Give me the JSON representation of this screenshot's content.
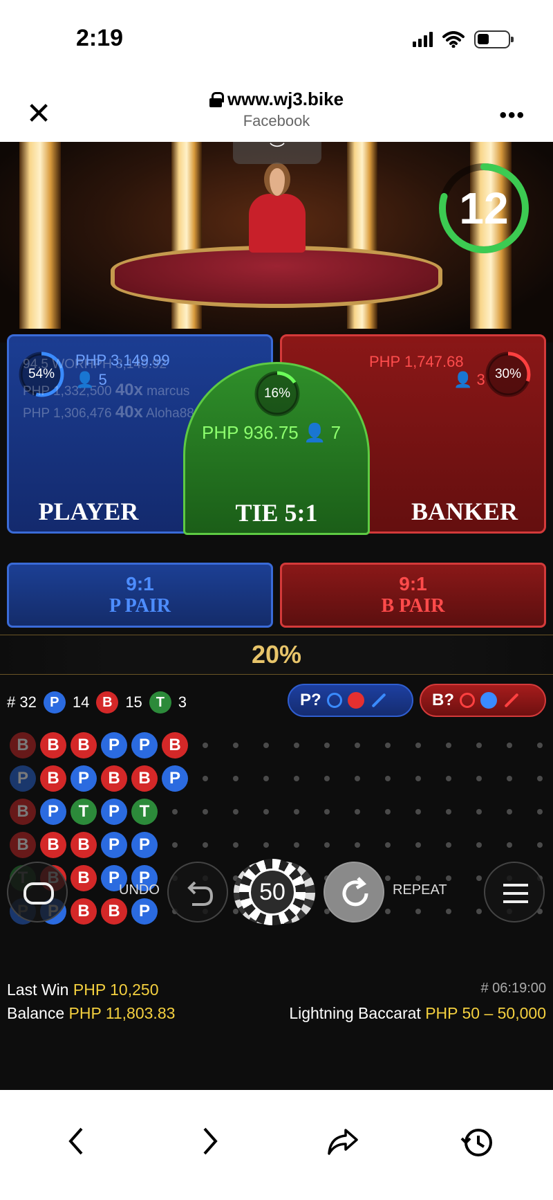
{
  "status_bar": {
    "time": "2:19"
  },
  "browser": {
    "url": "www.wj3.bike",
    "source": "Facebook"
  },
  "timer": {
    "seconds": "12"
  },
  "player": {
    "label": "PLAYER",
    "percent": "54%",
    "amount": "PHP 3,149.99",
    "players": "5",
    "ghost_rows": [
      {
        "text": "94.5 WORHPH 3,149.92"
      },
      {
        "amount": "PHP 1,332,500",
        "mult": "40x",
        "name": "marcus"
      },
      {
        "amount": "PHP 1,306,476",
        "mult": "40x",
        "name": "Aloha889"
      }
    ]
  },
  "tie": {
    "label": "TIE 5:1",
    "percent": "16%",
    "amount": "PHP 936.75",
    "players": "7"
  },
  "banker": {
    "label": "BANKER",
    "percent": "30%",
    "amount": "PHP 1,747.68",
    "players": "3"
  },
  "player_pair": {
    "odds": "9:1",
    "label": "P PAIR"
  },
  "banker_pair": {
    "odds": "9:1",
    "label": "B PAIR"
  },
  "multiplier": "20%",
  "stats": {
    "round": "# 32",
    "p_letter": "P",
    "p_count": "14",
    "b_letter": "B",
    "b_count": "15",
    "t_letter": "T",
    "t_count": "3"
  },
  "predictions": {
    "player": "P?",
    "banker": "B?"
  },
  "road": {
    "columns": [
      [
        "B",
        "P",
        "B",
        "B",
        "T",
        "P"
      ],
      [
        "B",
        "B",
        "P",
        "B",
        "B",
        "P"
      ],
      [
        "B",
        "P",
        "T",
        "B",
        "B",
        "B"
      ],
      [
        "P",
        "B",
        "P",
        "P",
        "P",
        "B"
      ],
      [
        "P",
        "B",
        "T",
        "P",
        "P",
        "P"
      ],
      [
        "B",
        "P"
      ]
    ]
  },
  "controls": {
    "undo": "UNDO",
    "chip_value": "50",
    "repeat": "REPEAT"
  },
  "footer": {
    "last_win_label": "Last Win",
    "last_win_value": "PHP 10,250",
    "balance_label": "Balance",
    "balance_value": "PHP 11,803.83",
    "round_id": "# 06:19:00",
    "game_name": "Lightning Baccarat",
    "limits": "PHP 50 – 50,000"
  },
  "colors": {
    "player": "#2b6be0",
    "banker": "#d42828",
    "tie": "#2c8a3a",
    "accent": "#f4d03f"
  }
}
